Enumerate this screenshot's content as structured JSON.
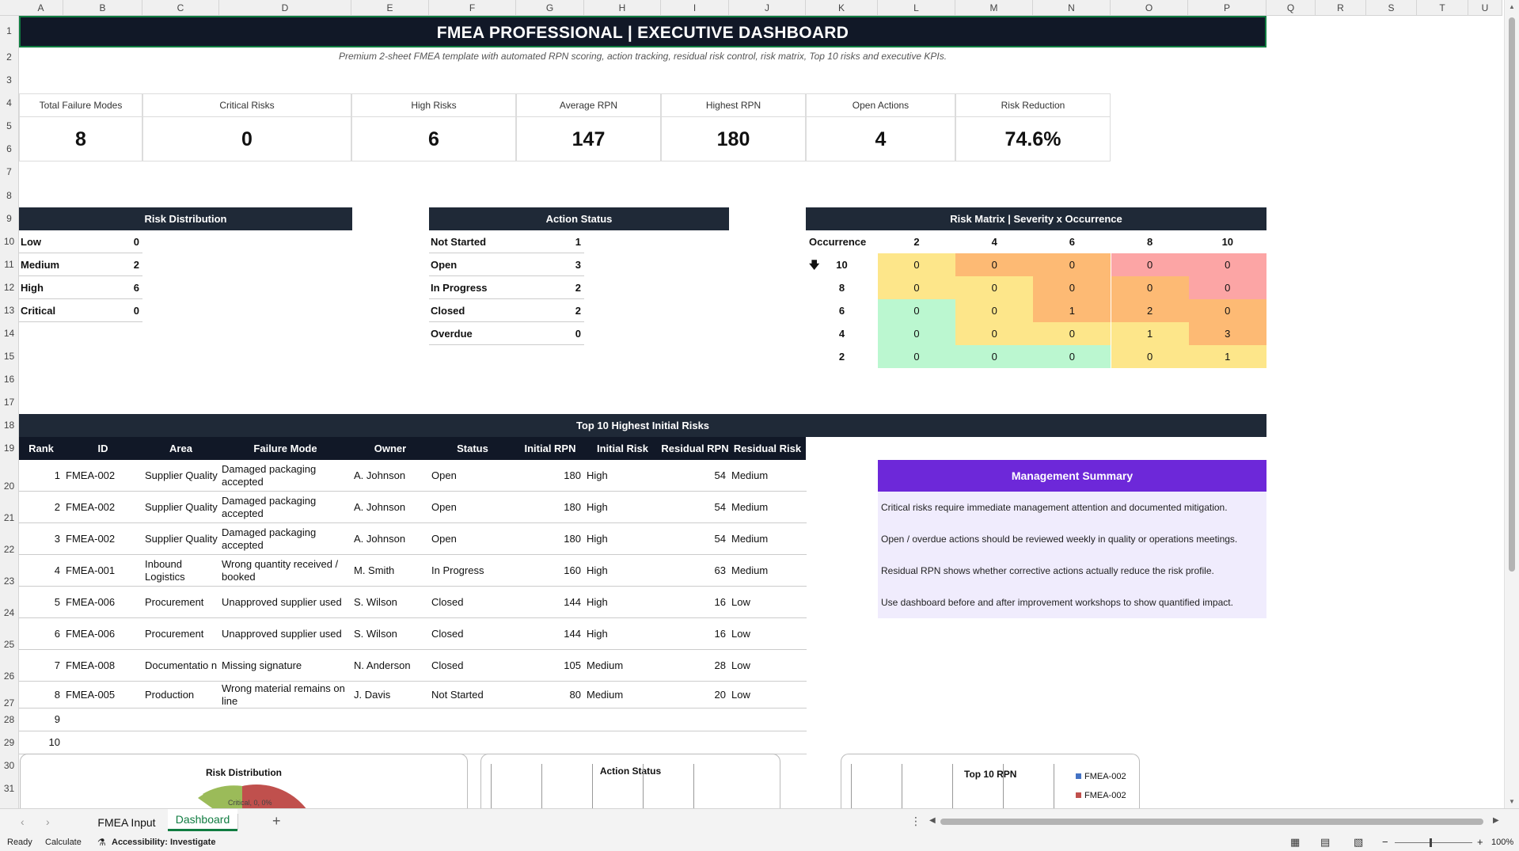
{
  "sheet": {
    "columns": [
      "A",
      "B",
      "C",
      "D",
      "E",
      "F",
      "G",
      "H",
      "I",
      "J",
      "K",
      "L",
      "M",
      "N",
      "O",
      "P",
      "Q",
      "R",
      "S",
      "T",
      "U"
    ],
    "rows": [
      "1",
      "2",
      "3",
      "4",
      "5",
      "6",
      "7",
      "8",
      "9",
      "10",
      "11",
      "12",
      "13",
      "14",
      "15",
      "16",
      "17",
      "18",
      "19",
      "20",
      "21",
      "22",
      "23",
      "24",
      "25",
      "26",
      "27",
      "28",
      "29",
      "30",
      "31"
    ]
  },
  "title": "FMEA PROFESSIONAL | EXECUTIVE DASHBOARD",
  "subtitle": "Premium 2-sheet FMEA template with automated RPN scoring, action tracking, residual risk control, risk matrix, Top 10 risks and executive KPIs.",
  "kpis": [
    {
      "label": "Total Failure Modes",
      "value": "8"
    },
    {
      "label": "Critical Risks",
      "value": "0"
    },
    {
      "label": "High Risks",
      "value": "6"
    },
    {
      "label": "Average RPN",
      "value": "147"
    },
    {
      "label": "Highest RPN",
      "value": "180"
    },
    {
      "label": "Open Actions",
      "value": "4"
    },
    {
      "label": "Risk Reduction",
      "value": "74.6%"
    }
  ],
  "risk_distribution": {
    "title": "Risk Distribution",
    "items": [
      {
        "label": "Low",
        "value": "0"
      },
      {
        "label": "Medium",
        "value": "2"
      },
      {
        "label": "High",
        "value": "6"
      },
      {
        "label": "Critical",
        "value": "0"
      }
    ]
  },
  "action_status": {
    "title": "Action Status",
    "items": [
      {
        "label": "Not Started",
        "value": "1"
      },
      {
        "label": "Open",
        "value": "3"
      },
      {
        "label": "In Progress",
        "value": "2"
      },
      {
        "label": "Closed",
        "value": "2"
      },
      {
        "label": "Overdue",
        "value": "0"
      }
    ]
  },
  "risk_matrix": {
    "title": "Risk Matrix | Severity x Occurrence",
    "corner_label": "Occurrence",
    "severity": [
      "2",
      "4",
      "6",
      "8",
      "10"
    ],
    "occurrence": [
      "10",
      "8",
      "6",
      "4",
      "2"
    ],
    "cells": [
      [
        "0",
        "0",
        "0",
        "0",
        "0"
      ],
      [
        "0",
        "0",
        "0",
        "0",
        "0"
      ],
      [
        "0",
        "0",
        "1",
        "2",
        "0"
      ],
      [
        "0",
        "0",
        "0",
        "1",
        "3"
      ],
      [
        "0",
        "0",
        "0",
        "0",
        "1"
      ]
    ],
    "colors": [
      [
        "#fde68a",
        "#fdba74",
        "#fdba74",
        "#fca5a5",
        "#fca5a5"
      ],
      [
        "#fde68a",
        "#fde68a",
        "#fdba74",
        "#fdba74",
        "#fca5a5"
      ],
      [
        "#bbf7d0",
        "#fde68a",
        "#fdba74",
        "#fdba74",
        "#fdba74"
      ],
      [
        "#bbf7d0",
        "#fde68a",
        "#fde68a",
        "#fde68a",
        "#fdba74"
      ],
      [
        "#bbf7d0",
        "#bbf7d0",
        "#bbf7d0",
        "#fde68a",
        "#fde68a"
      ]
    ]
  },
  "top10": {
    "title": "Top 10 Highest Initial Risks",
    "headers": [
      "Rank",
      "ID",
      "Area",
      "Failure Mode",
      "Owner",
      "Status",
      "Initial RPN",
      "Initial Risk",
      "Residual RPN",
      "Residual Risk"
    ],
    "rows": [
      [
        "1",
        "FMEA-002",
        "Supplier Quality",
        "Damaged packaging accepted",
        "A. Johnson",
        "Open",
        "180",
        "High",
        "54",
        "Medium"
      ],
      [
        "2",
        "FMEA-002",
        "Supplier Quality",
        "Damaged packaging accepted",
        "A. Johnson",
        "Open",
        "180",
        "High",
        "54",
        "Medium"
      ],
      [
        "3",
        "FMEA-002",
        "Supplier Quality",
        "Damaged packaging accepted",
        "A. Johnson",
        "Open",
        "180",
        "High",
        "54",
        "Medium"
      ],
      [
        "4",
        "FMEA-001",
        "Inbound Logistics",
        "Wrong quantity received / booked",
        "M. Smith",
        "In Progress",
        "160",
        "High",
        "63",
        "Medium"
      ],
      [
        "5",
        "FMEA-006",
        "Procurement",
        "Unapproved supplier used",
        "S. Wilson",
        "Closed",
        "144",
        "High",
        "16",
        "Low"
      ],
      [
        "6",
        "FMEA-006",
        "Procurement",
        "Unapproved supplier used",
        "S. Wilson",
        "Closed",
        "144",
        "High",
        "16",
        "Low"
      ],
      [
        "7",
        "FMEA-008",
        "Documentatio n",
        "Missing signature",
        "N. Anderson",
        "Closed",
        "105",
        "Medium",
        "28",
        "Low"
      ],
      [
        "8",
        "FMEA-005",
        "Production",
        "Wrong material remains on line",
        "J. Davis",
        "Not Started",
        "80",
        "Medium",
        "20",
        "Low"
      ],
      [
        "9",
        "",
        "",
        "",
        "",
        "",
        "",
        "",
        "",
        ""
      ],
      [
        "10",
        "",
        "",
        "",
        "",
        "",
        "",
        "",
        "",
        ""
      ]
    ]
  },
  "summary": {
    "title": "Management Summary",
    "lines": [
      "Critical risks require immediate management attention and documented mitigation.",
      "Open / overdue actions should be reviewed weekly in quality or operations meetings.",
      "Residual RPN shows whether corrective actions actually reduce the risk profile.",
      "Use dashboard before and after improvement workshops to show quantified impact."
    ]
  },
  "charts": {
    "risk_title": "Risk Distribution",
    "action_title": "Action Status",
    "top10_title": "Top 10 RPN",
    "legend": [
      "FMEA-002",
      "FMEA-002"
    ],
    "pie_label": "Critical, 0, 0%",
    "colors": {
      "blue": "#4472c4",
      "red": "#c0504d",
      "green": "#9bbb59"
    }
  },
  "chart_data": [
    {
      "type": "pie",
      "title": "Risk Distribution",
      "categories": [
        "Low",
        "Medium",
        "High",
        "Critical"
      ],
      "values": [
        0,
        2,
        6,
        0
      ]
    },
    {
      "type": "bar",
      "title": "Action Status",
      "categories": [
        "Not Started",
        "Open",
        "In Progress",
        "Closed",
        "Overdue"
      ],
      "values": [
        1,
        3,
        2,
        2,
        0
      ]
    },
    {
      "type": "bar",
      "title": "Top 10 RPN",
      "series": [
        {
          "name": "FMEA-002",
          "values": [
            180
          ]
        },
        {
          "name": "FMEA-002",
          "values": [
            180
          ]
        }
      ]
    }
  ],
  "tabs": {
    "items": [
      "FMEA Input",
      "Dashboard"
    ],
    "active": "Dashboard",
    "add": "+"
  },
  "status": {
    "ready": "Ready",
    "calculate": "Calculate",
    "accessibility": "Accessibility: Investigate",
    "zoom": "100%"
  },
  "theme": {
    "dark": "#111827",
    "purple": "#6d28d9",
    "excel_green": "#107c41"
  }
}
